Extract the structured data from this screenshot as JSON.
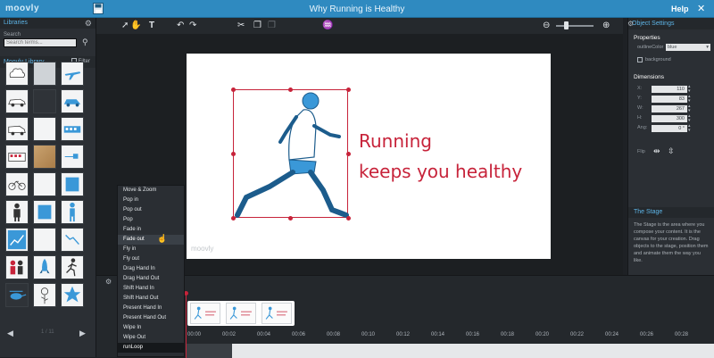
{
  "app": {
    "brand": "moovly",
    "title": "Why Running is Healthy",
    "help_label": "Help",
    "close_symbol": "✕"
  },
  "libraries": {
    "header": "Libraries",
    "search_label": "Search",
    "search_placeholder": "Search terms...",
    "library_title": "Moovly Library",
    "filter_label": "Filter",
    "pager_text": "1 / 11"
  },
  "stage": {
    "line1": "Running",
    "line2": "keeps you healthy",
    "watermark": "moovly",
    "text_color": "#c7233a"
  },
  "object_settings": {
    "header": "Object Settings",
    "properties_label": "Properties",
    "outline_color_label": "outlineColor",
    "outline_color_value": "blue",
    "background_label": "background",
    "dimensions_label": "Dimensions",
    "fields": [
      {
        "key": "X:",
        "value": "110"
      },
      {
        "key": "Y:",
        "value": "83"
      },
      {
        "key": "W:",
        "value": "267"
      },
      {
        "key": "H:",
        "value": "300"
      },
      {
        "key": "Ang:",
        "value": "0 °"
      }
    ],
    "flip_label": "Flip"
  },
  "help_panel": {
    "title": "The Stage",
    "body": "The Stage is the area where you compose your content. It is the canvas for your creation. Drag objects to the stage, position them and animate them the way you like."
  },
  "animation_menu": {
    "items": [
      "Move & Zoom",
      "Pop in",
      "Pop out",
      "Pop",
      "Fade in",
      "Fade out",
      "Fly in",
      "Fly out",
      "Drag Hand In",
      "Drag Hand Out",
      "Shift Hand In",
      "Shift Hand Out",
      "Present Hand In",
      "Present Hand Out",
      "Wipe In",
      "Wipe Out",
      "runLoop"
    ]
  },
  "timeline": {
    "ticks": [
      "00:00",
      "00:02",
      "00:04",
      "00:06",
      "00:08",
      "00:10",
      "00:12",
      "00:14",
      "00:16",
      "00:18",
      "00:20",
      "00:22",
      "00:24",
      "00:26",
      "00:28"
    ]
  },
  "colors": {
    "accent": "#2f8ac0",
    "panel": "#2b2f34",
    "highlight": "#5db4e6"
  }
}
